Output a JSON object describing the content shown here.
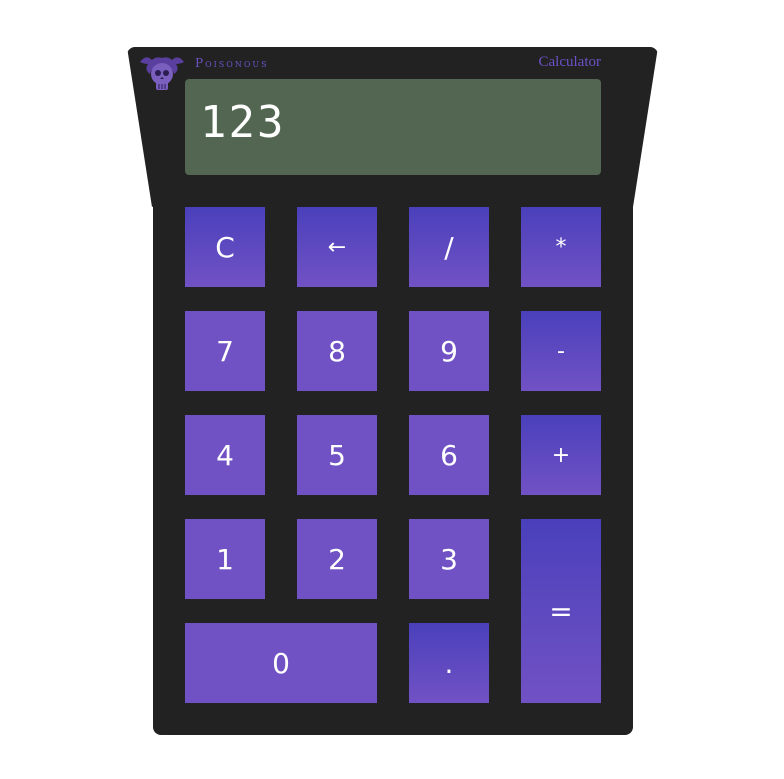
{
  "header": {
    "brand": "Poisonous",
    "title": "Calculator",
    "logo_icon": "skull-icon"
  },
  "display": {
    "value": "123"
  },
  "keys": {
    "clear": "C",
    "backspace": "←",
    "divide": "/",
    "multiply": "*",
    "seven": "7",
    "eight": "8",
    "nine": "9",
    "minus": "-",
    "four": "4",
    "five": "5",
    "six": "6",
    "plus": "+",
    "one": "1",
    "two": "2",
    "three": "3",
    "equals": "=",
    "zero": "0",
    "decimal": "."
  },
  "colors": {
    "body": "#222222",
    "display": "#526651",
    "key_top": "#4a40bb",
    "key_bottom": "#7152c4",
    "accent_text": "#6c52c6"
  }
}
